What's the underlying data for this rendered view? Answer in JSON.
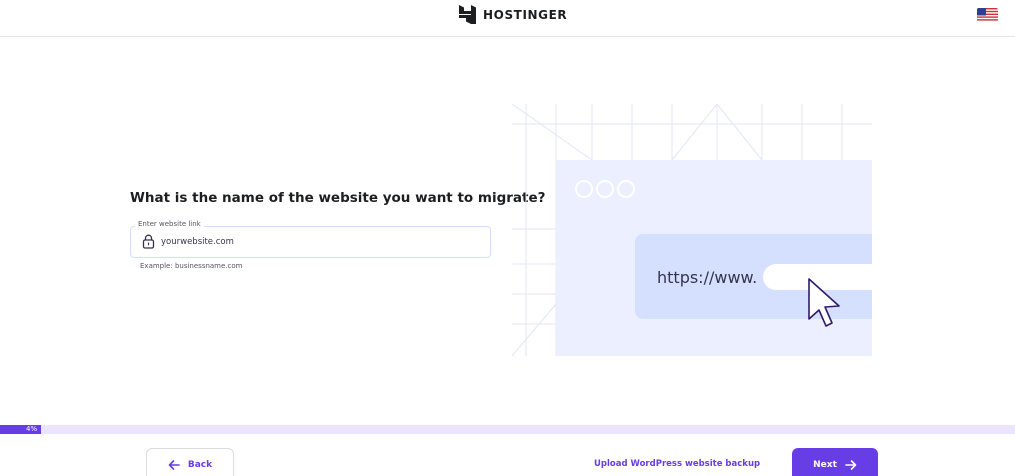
{
  "header": {
    "brand": "HOSTINGER",
    "logo_icon": "hostinger-logo-icon",
    "language_icon": "us-flag-icon"
  },
  "main": {
    "question": "What is the name of the website you want to migrate?",
    "website_field": {
      "label": "Enter website link",
      "placeholder": "yourwebsite.com",
      "value": "",
      "icon": "lock-icon",
      "hint": "Example: businessname.com"
    },
    "illustration": {
      "url_text": "https://www."
    }
  },
  "progress": {
    "percent": 4,
    "label": "4%"
  },
  "footer": {
    "back_label": "Back",
    "upload_label": "Upload WordPress website backup",
    "next_label": "Next"
  },
  "colors": {
    "accent": "#673de6",
    "progress_track": "#ebe4ff",
    "illustration_panel": "#ebefff",
    "illustration_bar": "#d5dfff"
  }
}
